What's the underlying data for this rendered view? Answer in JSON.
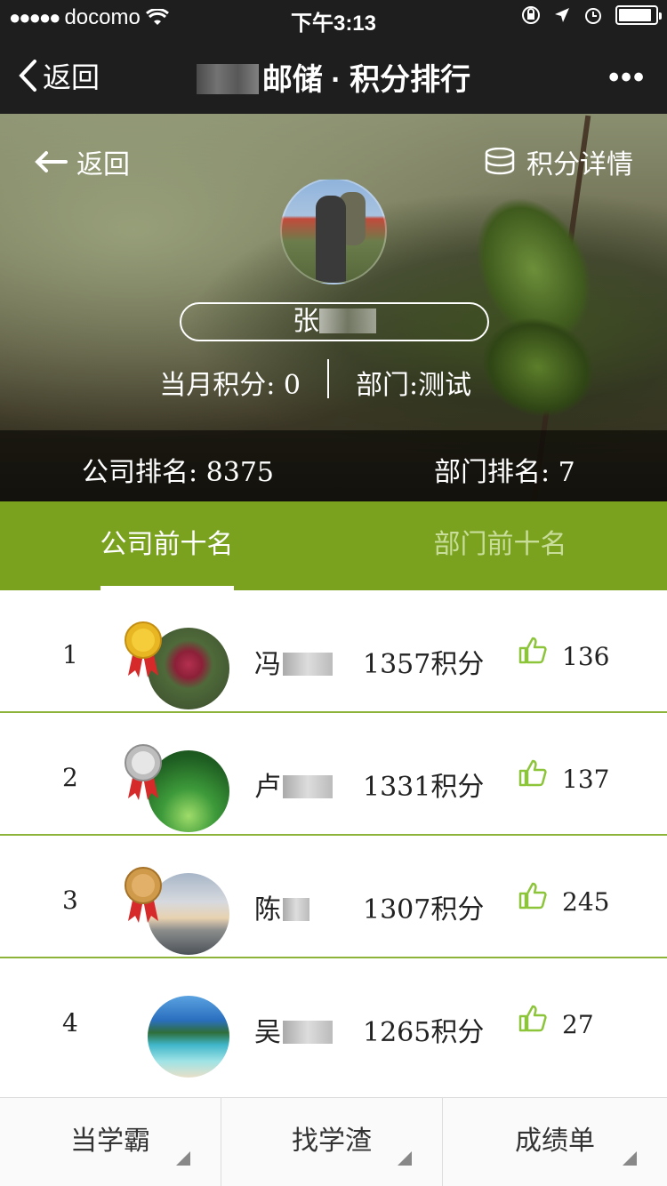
{
  "status": {
    "carrier": "docomo",
    "time": "下午3:13"
  },
  "nav": {
    "back_label": "返回",
    "title": "邮储 · 积分排行",
    "more": "•••"
  },
  "hero": {
    "back_label": "返回",
    "detail_label": "积分详情",
    "name": "张",
    "monthly": "当月积分: 0",
    "dept": "部门:测试",
    "company_rank": "公司排名: 8375",
    "dept_rank": "部门排名: 7"
  },
  "tabs": {
    "company_top": "公司前十名",
    "dept_top": "部门前十名"
  },
  "rows": [
    {
      "rank": "1",
      "name": "冯",
      "score": "1357积分",
      "likes": "136",
      "medal": "gold"
    },
    {
      "rank": "2",
      "name": "卢",
      "score": "1331积分",
      "likes": "137",
      "medal": "silver"
    },
    {
      "rank": "3",
      "name": "陈",
      "score": "1307积分",
      "likes": "245",
      "medal": "bronze"
    },
    {
      "rank": "4",
      "name": "吴",
      "score": "1265积分",
      "likes": "27",
      "medal": ""
    }
  ],
  "bottom": {
    "btn1": "当学霸",
    "btn2": "找学渣",
    "btn3": "成绩单"
  },
  "colors": {
    "accent": "#7aa21f",
    "thumb": "#8cc43a"
  },
  "battery_level": 0.9
}
